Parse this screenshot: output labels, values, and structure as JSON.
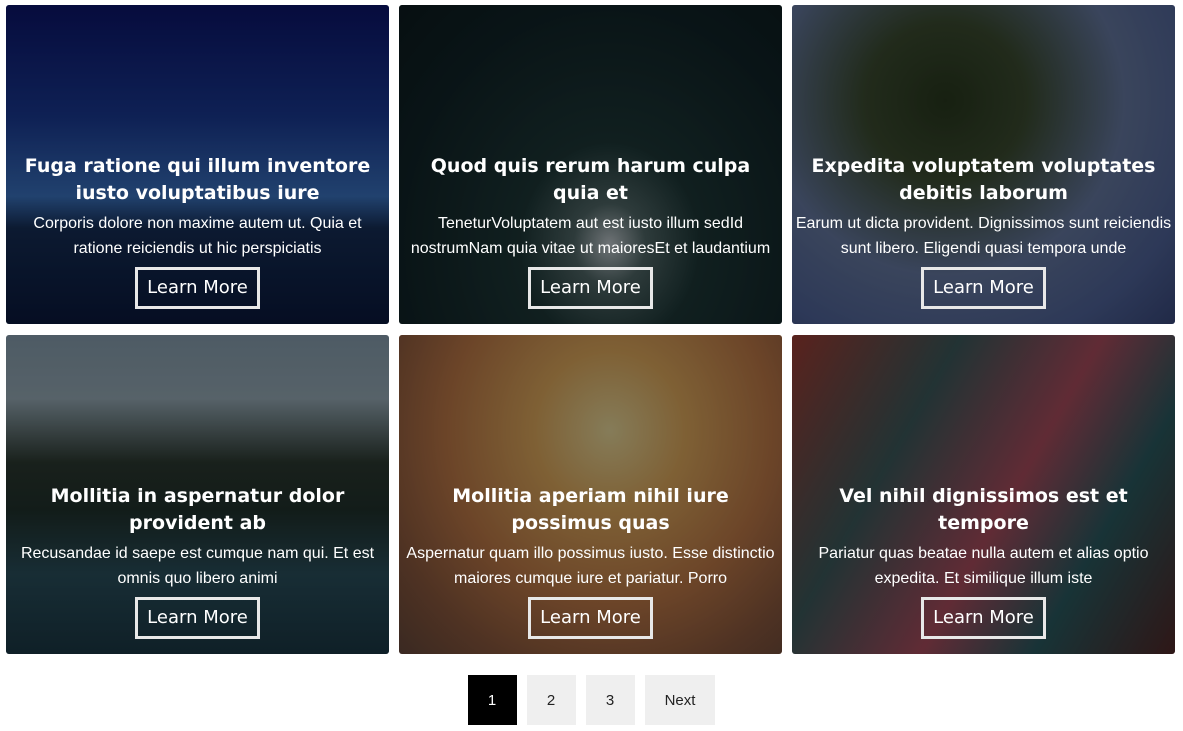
{
  "cards": [
    {
      "title": "Fuga ratione qui illum inventore iusto voluptatibus iure",
      "text": "Corporis dolore non maxime autem ut. Quia et ratione reiciendis ut hic perspiciatis",
      "button": "Learn More"
    },
    {
      "title": "Quod quis rerum harum culpa quia et",
      "text": "TeneturVoluptatem aut est iusto illum sedId nostrumNam quia vitae ut maioresEt et laudantium",
      "button": "Learn More"
    },
    {
      "title": "Expedita voluptatem voluptates debitis laborum",
      "text": "Earum ut dicta provident. Dignissimos sunt reiciendis sunt libero. Eligendi quasi tempora unde",
      "button": "Learn More"
    },
    {
      "title": "Mollitia in aspernatur dolor provident ab",
      "text": "Recusandae id saepe est cumque nam qui. Et est omnis quo libero animi",
      "button": "Learn More"
    },
    {
      "title": "Mollitia aperiam nihil iure possimus quas",
      "text": "Aspernatur quam illo possimus iusto. Esse distinctio maiores cumque iure et pariatur. Porro",
      "button": "Learn More"
    },
    {
      "title": "Vel nihil dignissimos est et tempore",
      "text": "Pariatur quas beatae nulla autem et alias optio expedita. Et similique illum iste",
      "button": "Learn More"
    }
  ],
  "pagination": {
    "pages": [
      "1",
      "2",
      "3"
    ],
    "active": "1",
    "next_label": "Next"
  }
}
